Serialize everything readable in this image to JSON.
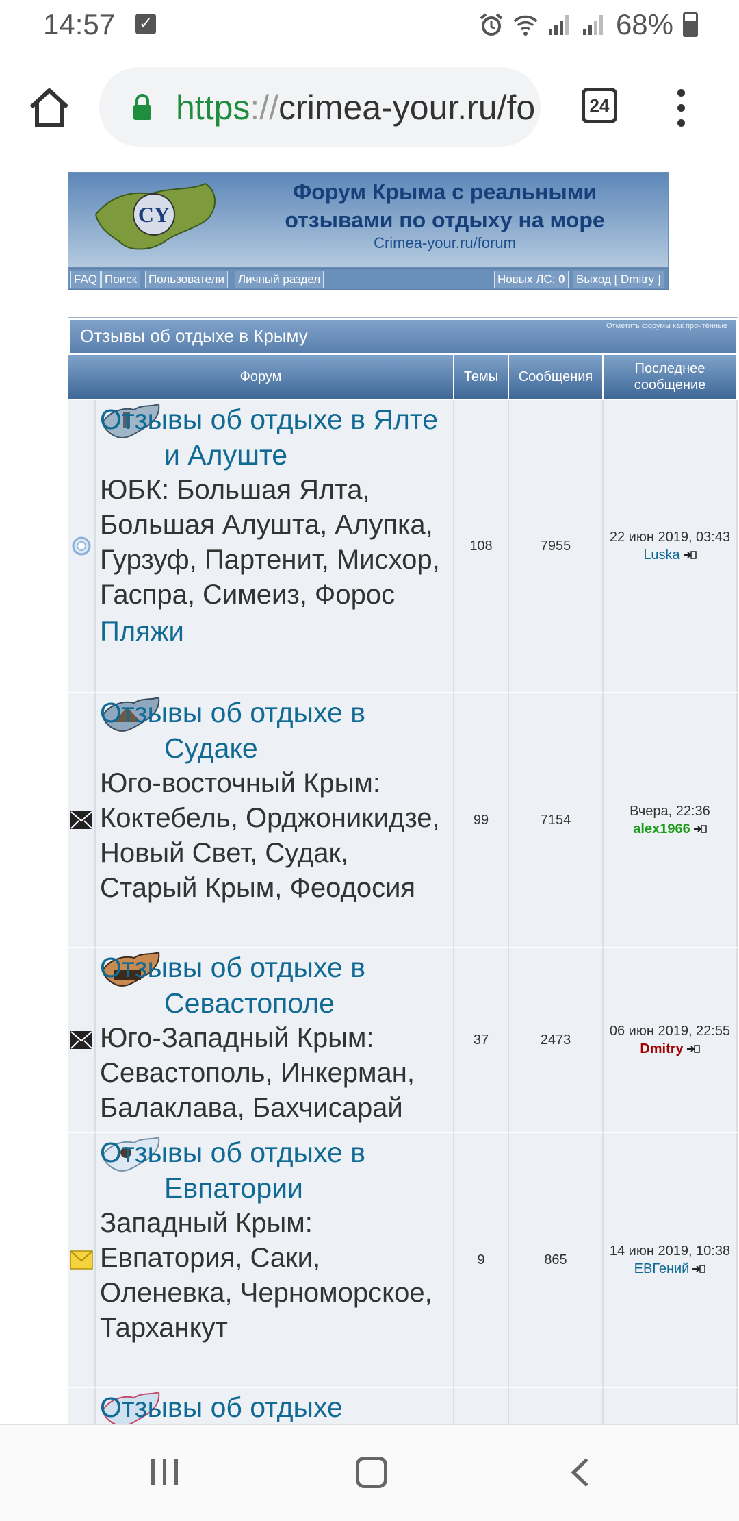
{
  "status": {
    "time": "14:57",
    "battery": "68%"
  },
  "browser": {
    "url_scheme": "https",
    "url_sep": "://",
    "url_host": "crimea-your.ru/fo",
    "tabs_count": "24"
  },
  "banner": {
    "title": "Форум Крыма с реальными отзывами по отдыху на море",
    "subtitle": "Crimea-your.ru/forum",
    "logo_text": "CY"
  },
  "nav": {
    "faq": "FAQ",
    "search": "Поиск",
    "users": "Пользователи",
    "personal": "Личный раздел",
    "new_pm": "Новых ЛС:",
    "new_pm_count": "0",
    "logout": "Выход [ Dmitry ]"
  },
  "category": {
    "title": "Отзывы об отдыхе в Крыму",
    "mark_read": "Отметить форумы как прочтённые"
  },
  "columns": {
    "forum": "Форум",
    "topics": "Темы",
    "posts": "Сообщения",
    "last": "Последнее сообщение"
  },
  "forums": [
    {
      "title": "Отзывы об отдыхе в Ялте и Алуште",
      "desc": "ЮБК: Большая Ялта, Большая Алушта, Алупка, Гурзуф, Партенит, Мисхор, Гаспра, Симеиз, Форос",
      "extra": "Пляжи",
      "topics": "108",
      "posts": "7955",
      "last_date": "22 июн 2019, 03:43",
      "last_user": "Luska"
    },
    {
      "title": "Отзывы об отдыхе в Судаке",
      "desc": "Юго-восточный Крым: Коктебель, Орджоникидзе, Новый Свет, Судак, Старый Крым, Феодосия",
      "topics": "99",
      "posts": "7154",
      "last_date": "Вчера, 22:36",
      "last_user": "alex1966"
    },
    {
      "title": "Отзывы об отдыхе в Севастополе",
      "desc": "Юго-Западный Крым: Севастополь, Инкерман, Балаклава, Бахчисарай",
      "topics": "37",
      "posts": "2473",
      "last_date": "06 июн 2019, 22:55",
      "last_user": "Dmitry"
    },
    {
      "title": "Отзывы об отдыхе в Евпатории",
      "desc": "Западный Крым: Евпатория, Саки, Оленевка, Черноморское, Тарханкут",
      "topics": "9",
      "posts": "865",
      "last_date": "14 июн 2019, 10:38",
      "last_user": "ЕВГений"
    },
    {
      "title": "Отзывы об отдыхе"
    }
  ],
  "colors": {
    "link": "#106a94",
    "header": "#5a80ad",
    "row_bg": "#edf1f5"
  }
}
